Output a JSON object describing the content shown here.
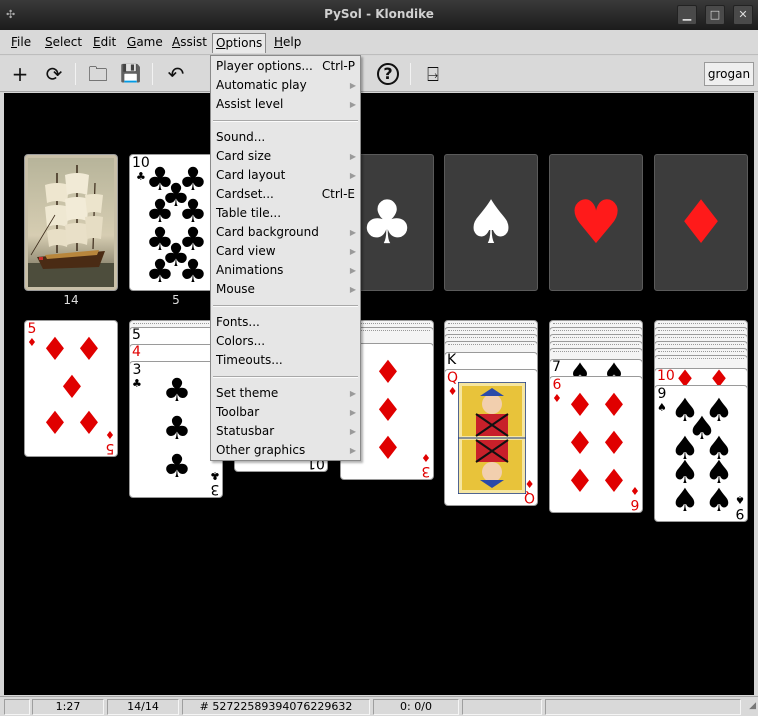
{
  "window": {
    "title": "PySol - Klondike",
    "minimize_glyph": "▁",
    "maximize_glyph": "□",
    "close_glyph": "✕"
  },
  "menubar": {
    "items": [
      {
        "label": "File",
        "u": "F",
        "rest": "ile"
      },
      {
        "label": "Select",
        "u": "S",
        "rest": "elect"
      },
      {
        "label": "Edit",
        "u": "E",
        "rest": "dit"
      },
      {
        "label": "Game",
        "u": "G",
        "rest": "ame"
      },
      {
        "label": "Assist",
        "u": "A",
        "rest": "ssist"
      },
      {
        "label": "Options",
        "u": "O",
        "rest": "ptions"
      },
      {
        "label": "Help",
        "u": "H",
        "rest": "elp"
      }
    ]
  },
  "toolbar": {
    "new_icon": "+",
    "restart_icon": "⟳",
    "open_icon": "🗀",
    "save_icon": "💾",
    "undo_icon": "↶",
    "help_icon": "?",
    "quit_icon": "⍈",
    "player_name": "grogan"
  },
  "options_menu": {
    "items": [
      {
        "label": "Player options...",
        "accel": "Ctrl-P",
        "submenu": false
      },
      {
        "label": "Automatic play",
        "accel": "",
        "submenu": true
      },
      {
        "label": "Assist level",
        "accel": "",
        "submenu": true
      },
      {
        "label": "Sound...",
        "accel": "",
        "submenu": false
      },
      {
        "label": "Card size",
        "accel": "",
        "submenu": true
      },
      {
        "label": "Card layout",
        "accel": "",
        "submenu": true
      },
      {
        "label": "Cardset...",
        "accel": "Ctrl-E",
        "submenu": false
      },
      {
        "label": "Table tile...",
        "accel": "",
        "submenu": false
      },
      {
        "label": "Card background",
        "accel": "",
        "submenu": true
      },
      {
        "label": "Card view",
        "accel": "",
        "submenu": true
      },
      {
        "label": "Animations",
        "accel": "",
        "submenu": true
      },
      {
        "label": "Mouse",
        "accel": "",
        "submenu": true
      },
      {
        "label": "Fonts...",
        "accel": "",
        "submenu": false
      },
      {
        "label": "Colors...",
        "accel": "",
        "submenu": false
      },
      {
        "label": "Timeouts...",
        "accel": "",
        "submenu": false
      },
      {
        "label": "Set theme",
        "accel": "",
        "submenu": true
      },
      {
        "label": "Toolbar",
        "accel": "",
        "submenu": true
      },
      {
        "label": "Statusbar",
        "accel": "",
        "submenu": true
      },
      {
        "label": "Other graphics",
        "accel": "",
        "submenu": true
      }
    ]
  },
  "game": {
    "stock_count": "14",
    "waste_count": "5",
    "waste_card": {
      "rank": "10",
      "suit": "♣"
    },
    "foundations": [
      {
        "suit": "♣",
        "color": "#ffffff"
      },
      {
        "suit": "♠",
        "color": "#ffffff"
      },
      {
        "suit": "♥",
        "color": "#ff1a1a"
      },
      {
        "suit": "♦",
        "color": "#ff1a1a"
      }
    ],
    "tableau": {
      "col1_top": {
        "rank": "5",
        "suit": "♦"
      },
      "col2_visible": [
        {
          "rank": "5",
          "suit": "♣"
        },
        {
          "rank": "4",
          "suit": "♦"
        }
      ],
      "col2_top": {
        "rank": "3",
        "suit": "♣"
      },
      "col3_partial": "01",
      "col4_top": {
        "rank": "3",
        "suit": "♦"
      },
      "col5_visible": {
        "rank": "K",
        "suit": "♠"
      },
      "col5_top": {
        "rank": "Q",
        "suit": "♦"
      },
      "col6_visible": {
        "rank": "7",
        "suit": "♠"
      },
      "col6_top": {
        "rank": "6",
        "suit": "♦"
      },
      "col7_visible": {
        "rank": "10",
        "suit": "♦"
      },
      "col7_top": {
        "rank": "9",
        "suit": "♠"
      }
    }
  },
  "statusbar": {
    "time": "1:27",
    "cards": "14/14",
    "game_number": "# 52722589394076229632",
    "moves": "0: 0/0"
  }
}
